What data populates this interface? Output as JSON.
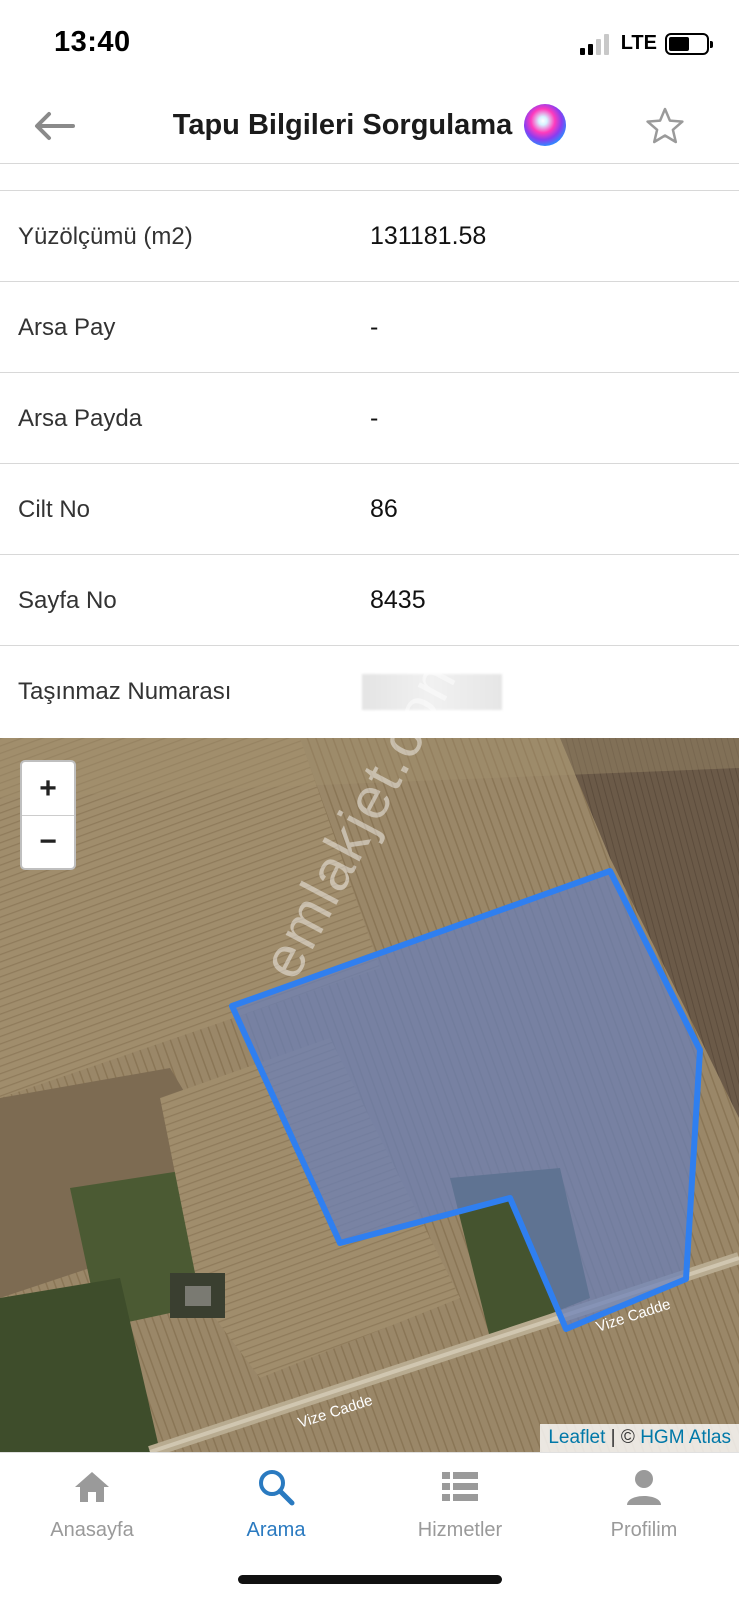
{
  "status_bar": {
    "time": "13:40",
    "network": "LTE"
  },
  "header": {
    "title": "Tapu Bilgileri Sorgulama",
    "back_icon": "arrow-left-icon",
    "siri_icon": "siri-icon",
    "favorite_icon": "star-outline-icon"
  },
  "info": {
    "rows": [
      {
        "label": "Yüzölçümü (m2)",
        "value": "131181.58"
      },
      {
        "label": "Arsa Pay",
        "value": "-"
      },
      {
        "label": "Arsa Payda",
        "value": "-"
      },
      {
        "label": "Cilt No",
        "value": "86"
      },
      {
        "label": "Sayfa No",
        "value": "8435"
      },
      {
        "label": "Taşınmaz Numarası",
        "value": ""
      }
    ]
  },
  "map": {
    "zoom_in": "+",
    "zoom_out": "−",
    "street_label_1": "Vize Cadde",
    "street_label_2": "Vize Cadde",
    "attribution_leaflet": "Leaflet",
    "attribution_sep": " | © ",
    "attribution_hgm": "HGM Atlas",
    "parcel_outline_color": "#2f7ff0",
    "parcel_fill_color": "#6a7fb8",
    "watermark": "emlakjet.com"
  },
  "tabs": [
    {
      "label": "Anasayfa",
      "icon": "home-icon",
      "active": false
    },
    {
      "label": "Arama",
      "icon": "search-icon",
      "active": true
    },
    {
      "label": "Hizmetler",
      "icon": "list-icon",
      "active": false
    },
    {
      "label": "Profilim",
      "icon": "user-icon",
      "active": false
    }
  ],
  "colors": {
    "accent": "#2a7ac0",
    "inactive_tab": "#9a9a9a"
  }
}
